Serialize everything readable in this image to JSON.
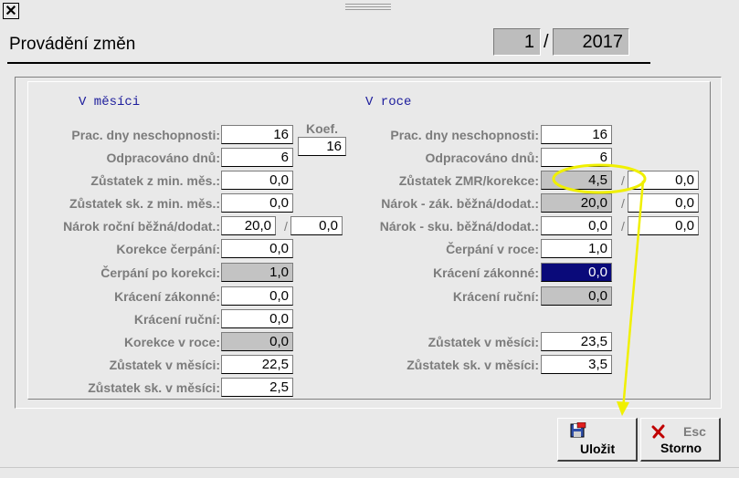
{
  "window": {
    "close_glyph": "✕"
  },
  "header": {
    "title": "Provádění změn",
    "month": "1",
    "slash": "/",
    "year": "2017"
  },
  "month_section": {
    "heading": "V měsíci",
    "koef_label": "Koef.",
    "koef_value": "16",
    "rows": [
      {
        "label": "Prac. dny neschopnosti:",
        "value": "16"
      },
      {
        "label": "Odpracováno dnů:",
        "value": "6"
      },
      {
        "label": "Zůstatek z min. měs.:",
        "value": "0,0"
      },
      {
        "label": "Zůstatek sk. z min. měs.:",
        "value": "0,0"
      },
      {
        "label": "Nárok roční běžná/dodat.:",
        "value": "20,0",
        "value2": "0,0"
      },
      {
        "label": "Korekce čerpání:",
        "value": "0,0"
      },
      {
        "label": "Čerpání po korekci:",
        "value": "1,0"
      },
      {
        "label": "Krácení zákonné:",
        "value": "0,0"
      },
      {
        "label": "Krácení ruční:",
        "value": "0,0"
      },
      {
        "label": "Korekce v roce:",
        "value": "0,0"
      },
      {
        "label": "Zůstatek v měsíci:",
        "value": "22,5"
      },
      {
        "label": "Zůstatek sk. v měsíci:",
        "value": "2,5"
      }
    ]
  },
  "year_section": {
    "heading": "V roce",
    "rows": [
      {
        "label": "Prac. dny neschopnosti:",
        "value": "16"
      },
      {
        "label": "Odpracováno dnů:",
        "value": "6"
      },
      {
        "label": "Zůstatek ZMR/korekce:",
        "value": "4,5",
        "value2": "0,0"
      },
      {
        "label": "Nárok - zák. běžná/dodat.:",
        "value": "20,0",
        "value2": "0,0"
      },
      {
        "label": "Nárok - sku. běžná/dodat.:",
        "value": "0,0",
        "value2": "0,0"
      },
      {
        "label": "Čerpání v roce:",
        "value": "1,0"
      },
      {
        "label": "Krácení zákonné:",
        "value": "0,0"
      },
      {
        "label": "Krácení ruční:",
        "value": "0,0"
      },
      {
        "label": "Zůstatek v měsíci:",
        "value": "23,5"
      },
      {
        "label": "Zůstatek sk. v měsíci:",
        "value": "3,5"
      }
    ]
  },
  "buttons": {
    "save_label": "Uložit",
    "cancel_label": "Storno",
    "cancel_hotkey": "Esc"
  },
  "colors": {
    "section_heading": "#1c1c9c",
    "highlight_field": "#0a0a7a",
    "annotation": "#f0f000"
  }
}
